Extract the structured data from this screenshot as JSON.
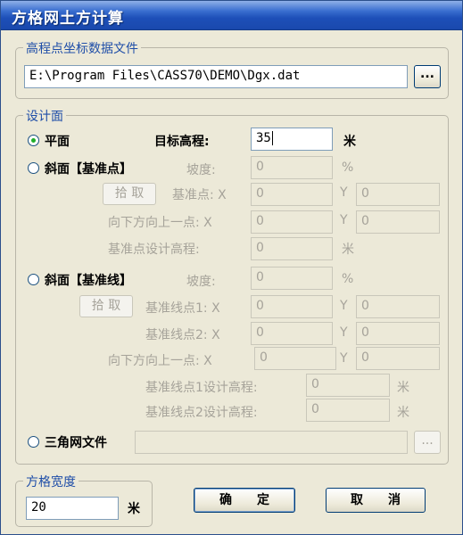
{
  "window": {
    "title": "方格网土方计算"
  },
  "elevation_file": {
    "legend": "高程点坐标数据文件",
    "path": "E:\\Program Files\\CASS70\\DEMO\\Dgx.dat",
    "browse_label": "..."
  },
  "design_surface": {
    "legend": "设计面",
    "plane": {
      "label": "平面",
      "selected": true,
      "target_label": "目标高程:",
      "target_value": "35",
      "unit": "米"
    },
    "slope_point": {
      "label": "斜面【基准点】",
      "slope_label": "坡度:",
      "slope_value": "0",
      "slope_unit": "%",
      "pick_label": "拾 取",
      "base_point_label": "基准点: X",
      "base_x": "0",
      "y_label": "Y",
      "base_y": "0",
      "down_point_label": "向下方向上一点: X",
      "down_x": "0",
      "down_y": "0",
      "design_elev_label": "基准点设计高程:",
      "design_elev": "0",
      "unit": "米"
    },
    "slope_line": {
      "label": "斜面【基准线】",
      "slope_label": "坡度:",
      "slope_value": "0",
      "slope_unit": "%",
      "pick_label": "拾 取",
      "p1_label": "基准线点1: X",
      "p1_x": "0",
      "p1_y": "0",
      "p2_label": "基准线点2: X",
      "p2_x": "0",
      "p2_y": "0",
      "down_label": "向下方向上一点: X",
      "down_x": "0",
      "down_y": "0",
      "y_label": "Y",
      "elev1_label": "基准线点1设计高程:",
      "elev1": "0",
      "elev2_label": "基准线点2设计高程:",
      "elev2": "0",
      "unit": "米"
    },
    "tin": {
      "label": "三角网文件",
      "value": "",
      "browse_label": "..."
    }
  },
  "grid_width": {
    "legend": "方格宽度",
    "value": "20",
    "unit": "米"
  },
  "buttons": {
    "ok": "确　　定",
    "cancel": "取　　消"
  },
  "colors": {
    "title_bar": "#1d4fb8",
    "legend_text": "#1f4ea8",
    "radio_selected": "#1fae2a"
  }
}
